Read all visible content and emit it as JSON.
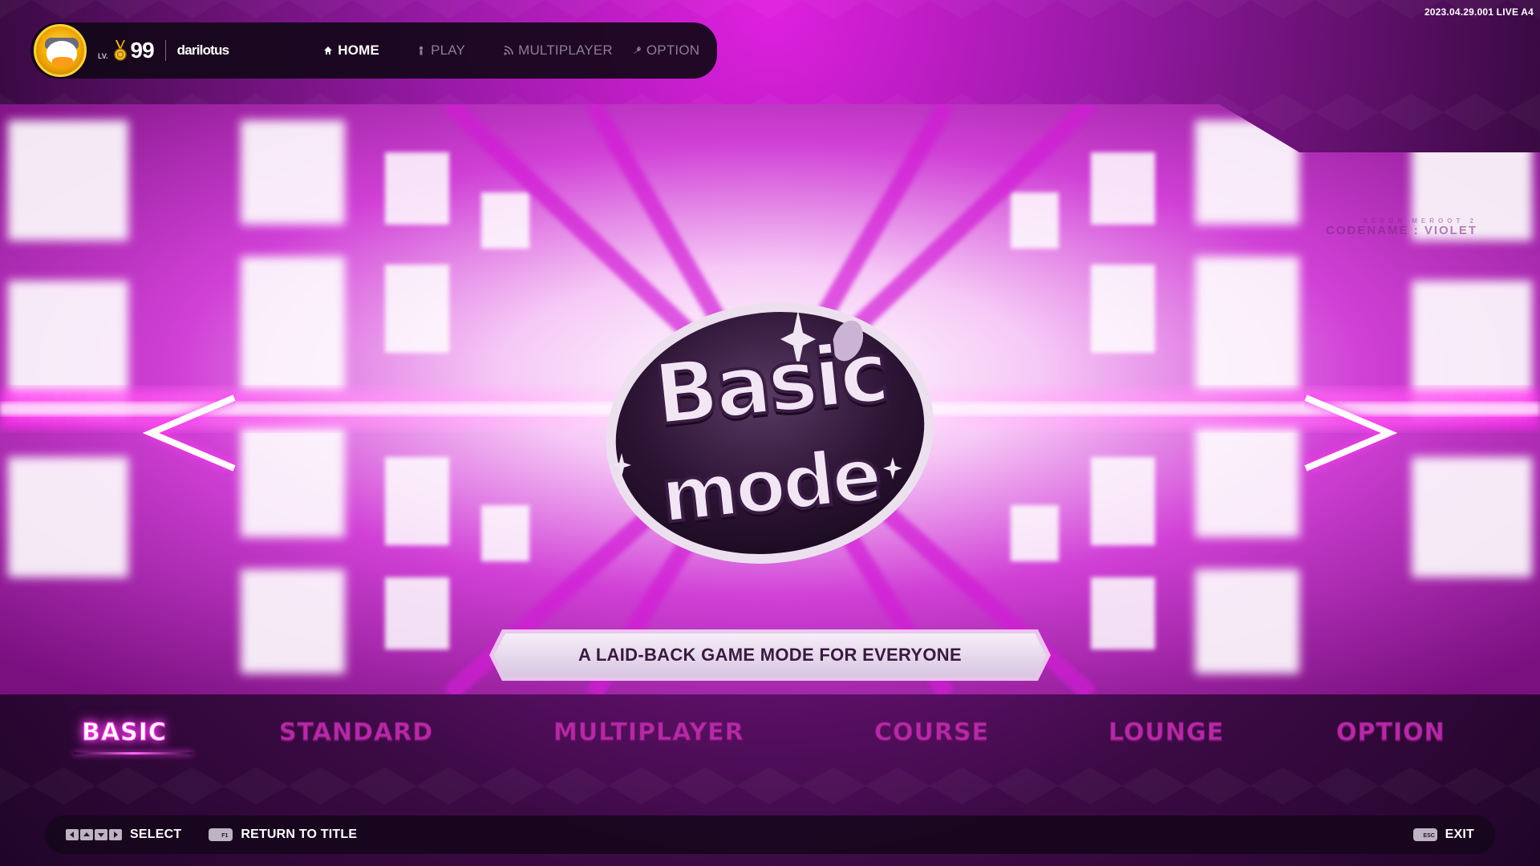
{
  "build": {
    "version": "2023.04.29.001 LIVE A4"
  },
  "player": {
    "level_prefix": "LV.",
    "level": "99",
    "name": "darilotus"
  },
  "nav": {
    "items": [
      {
        "label": "HOME",
        "icon": "home-icon",
        "active": true
      },
      {
        "label": "PLAY",
        "icon": "player-icon",
        "active": false
      },
      {
        "label": "MULTIPLAYER",
        "icon": "signal-icon",
        "active": false
      },
      {
        "label": "OPTION",
        "icon": "wrench-icon",
        "active": false
      }
    ]
  },
  "hero": {
    "corner_small": "SERON MEROOT 2",
    "corner_text": "CODENAME : VIOLET",
    "logo_title": "Basic",
    "logo_sub": "mode",
    "tagline": "A LAID-BACK GAME MODE FOR EVERYONE"
  },
  "mode_tabs": [
    {
      "label": "BASIC",
      "active": true
    },
    {
      "label": "STANDARD",
      "active": false
    },
    {
      "label": "MULTIPLAYER",
      "active": false
    },
    {
      "label": "COURSE",
      "active": false
    },
    {
      "label": "LOUNGE",
      "active": false
    },
    {
      "label": "OPTION",
      "active": false
    }
  ],
  "bottom_bar": {
    "select_label": "SELECT",
    "return_key": "F1",
    "return_label": "RETURN TO TITLE",
    "exit_key": "ESC",
    "exit_label": "EXIT"
  },
  "colors": {
    "accent": "#ff3cf0",
    "tab_inactive": "#b52aa8",
    "bar_bg": "#16061c"
  }
}
